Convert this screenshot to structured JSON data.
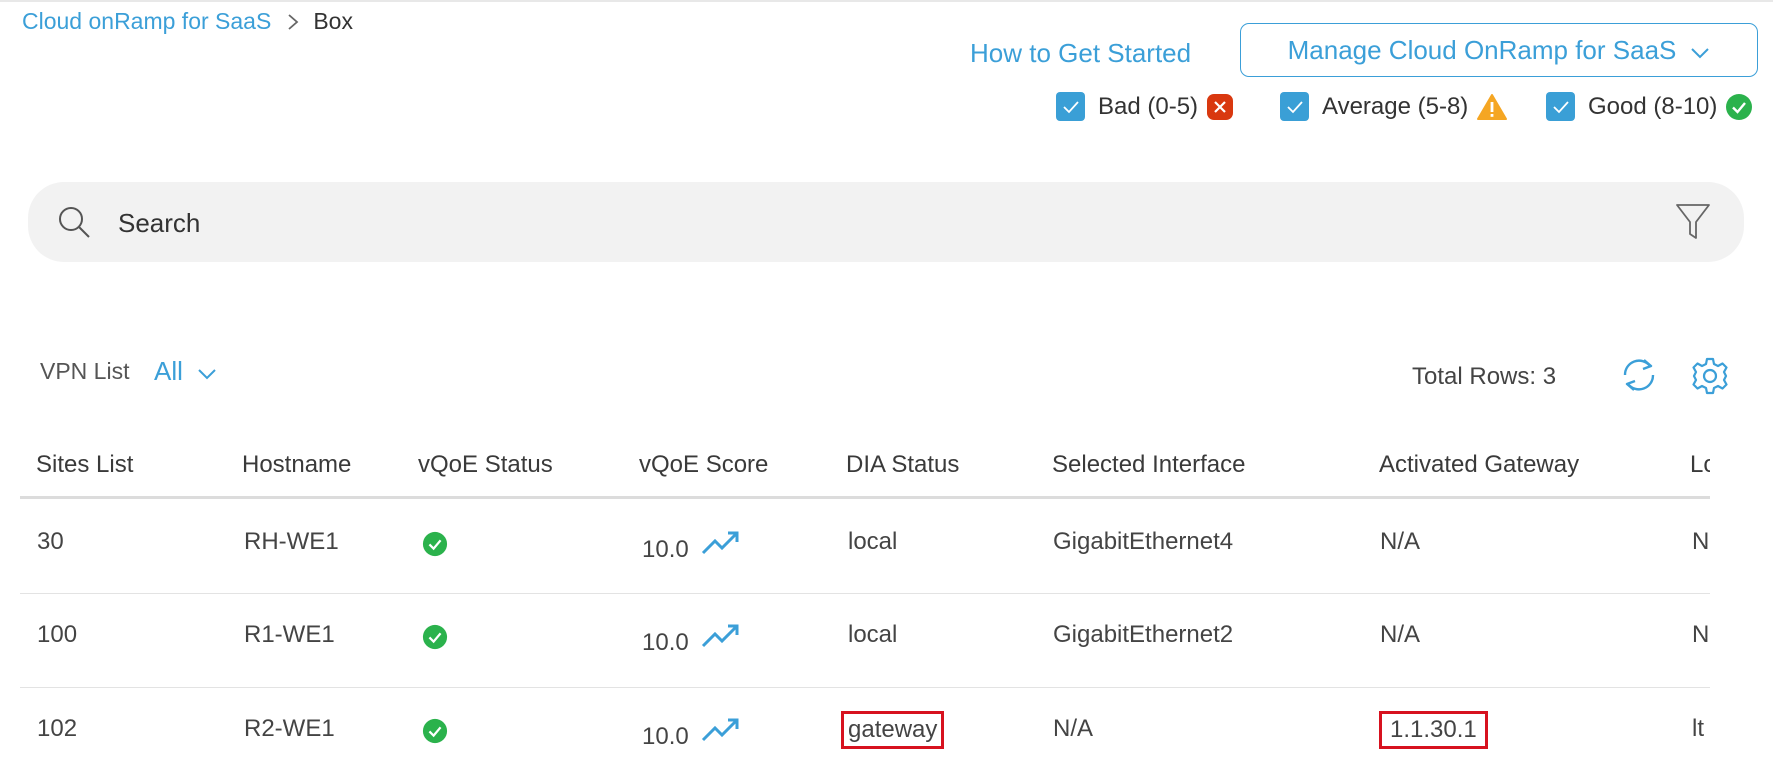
{
  "breadcrumb": {
    "parent": "Cloud onRamp for SaaS",
    "current": "Box"
  },
  "header": {
    "how_to_link": "How to Get Started",
    "manage_button": "Manage Cloud OnRamp for SaaS"
  },
  "legend": [
    {
      "label": "Bad (0-5)",
      "checked": true,
      "icon": "error-icon",
      "color": "#d9380f"
    },
    {
      "label": "Average (5-8)",
      "checked": true,
      "icon": "warning-icon",
      "color": "#f5a623"
    },
    {
      "label": "Good (8-10)",
      "checked": true,
      "icon": "check-circle-icon",
      "color": "#2bb24c"
    }
  ],
  "search": {
    "placeholder": "Search"
  },
  "toolbar": {
    "vpn_label": "VPN List",
    "vpn_value": "All",
    "total_rows": "Total Rows: 3"
  },
  "colors": {
    "accent": "#3b9fd8",
    "good": "#2bb24c",
    "highlight_border": "#d7121f"
  },
  "table": {
    "columns": [
      "Sites List",
      "Hostname",
      "vQoE Status",
      "vQoE Score",
      "DIA Status",
      "Selected Interface",
      "Activated Gateway",
      "Lo"
    ],
    "rows": [
      {
        "site": "30",
        "hostname": "RH-WE1",
        "vqoe_status": "good",
        "vqoe_score": "10.0",
        "dia_status": "local",
        "interface": "GigabitEthernet4",
        "gateway": "N/A",
        "last": "N"
      },
      {
        "site": "100",
        "hostname": "R1-WE1",
        "vqoe_status": "good",
        "vqoe_score": "10.0",
        "dia_status": "local",
        "interface": "GigabitEthernet2",
        "gateway": "N/A",
        "last": "N"
      },
      {
        "site": "102",
        "hostname": "R2-WE1",
        "vqoe_status": "good",
        "vqoe_score": "10.0",
        "dia_status": "gateway",
        "interface": "N/A",
        "gateway": "1.1.30.1",
        "last": "lt"
      }
    ]
  }
}
